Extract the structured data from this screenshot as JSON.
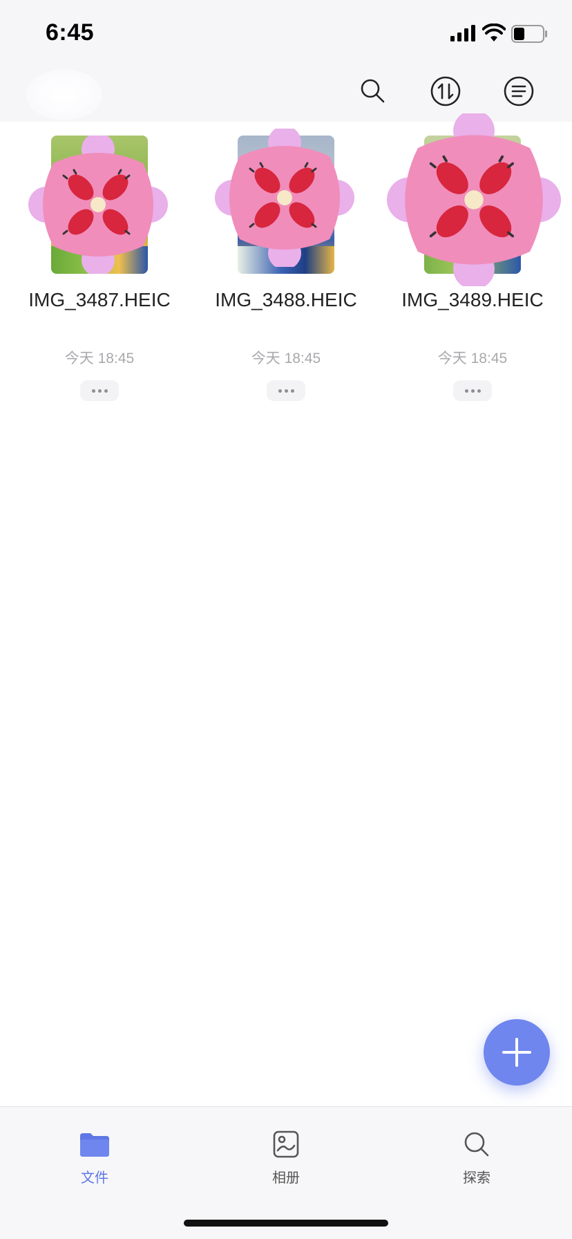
{
  "status_bar": {
    "time": "6:45",
    "icons": [
      "signal-icon",
      "wifi-icon",
      "battery-icon"
    ]
  },
  "toolbar": {
    "buttons": [
      "search-icon",
      "sort-icon",
      "menu-icon"
    ]
  },
  "files": [
    {
      "name": "IMG_3487.HEIC",
      "time": "今天 18:45"
    },
    {
      "name": "IMG_3488.HEIC",
      "time": "今天 18:45"
    },
    {
      "name": "IMG_3489.HEIC",
      "time": "今天 18:45"
    }
  ],
  "fab": {
    "icon": "plus-icon"
  },
  "tabs": [
    {
      "label": "文件",
      "icon": "folder-icon",
      "active": true
    },
    {
      "label": "相册",
      "icon": "album-icon",
      "active": false
    },
    {
      "label": "探索",
      "icon": "search-icon",
      "active": false
    }
  ],
  "colors": {
    "accent": "#6f86ee",
    "tab_active": "#5f77e6",
    "tab_inactive": "#555555",
    "muted_text": "#a9a9ad"
  }
}
